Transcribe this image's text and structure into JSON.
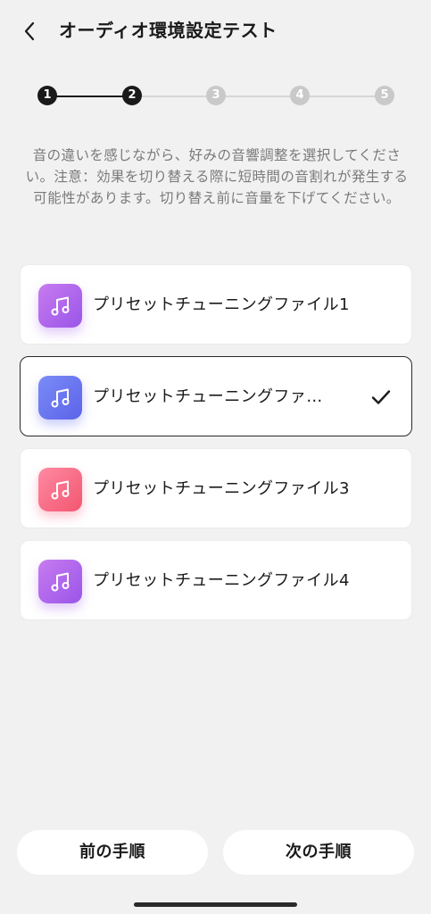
{
  "header": {
    "title": "オーディオ環境設定テスト"
  },
  "stepper": {
    "steps": [
      "1",
      "2",
      "3",
      "4",
      "5"
    ],
    "current_step": 2
  },
  "description": "音の違いを感じながら、好みの音響調整を選択してください。注意：効果を切り替える際に短時間の音割れが発生する可能性があります。切り替え前に音量を下げてください。",
  "presets": [
    {
      "label": "プリセットチューニングファイル1",
      "icon": "music-note-icon",
      "color": "purple",
      "selected": false
    },
    {
      "label": "プリセットチューニングファ…",
      "icon": "music-note-icon",
      "color": "blue",
      "selected": true
    },
    {
      "label": "プリセットチューニングファイル3",
      "icon": "music-note-icon",
      "color": "pink",
      "selected": false
    },
    {
      "label": "プリセットチューニングファイル4",
      "icon": "music-note-icon",
      "color": "purple",
      "selected": false
    }
  ],
  "buttons": {
    "prev_label": "前の手順",
    "next_label": "次の手順"
  },
  "colors": {
    "background": "#f1f1f1",
    "active_step": "#1a1a1a",
    "inactive_step": "#c9c9c9",
    "icon_purple": "#b168ec",
    "icon_blue": "#6b77f0",
    "icon_pink": "#f76e86"
  }
}
